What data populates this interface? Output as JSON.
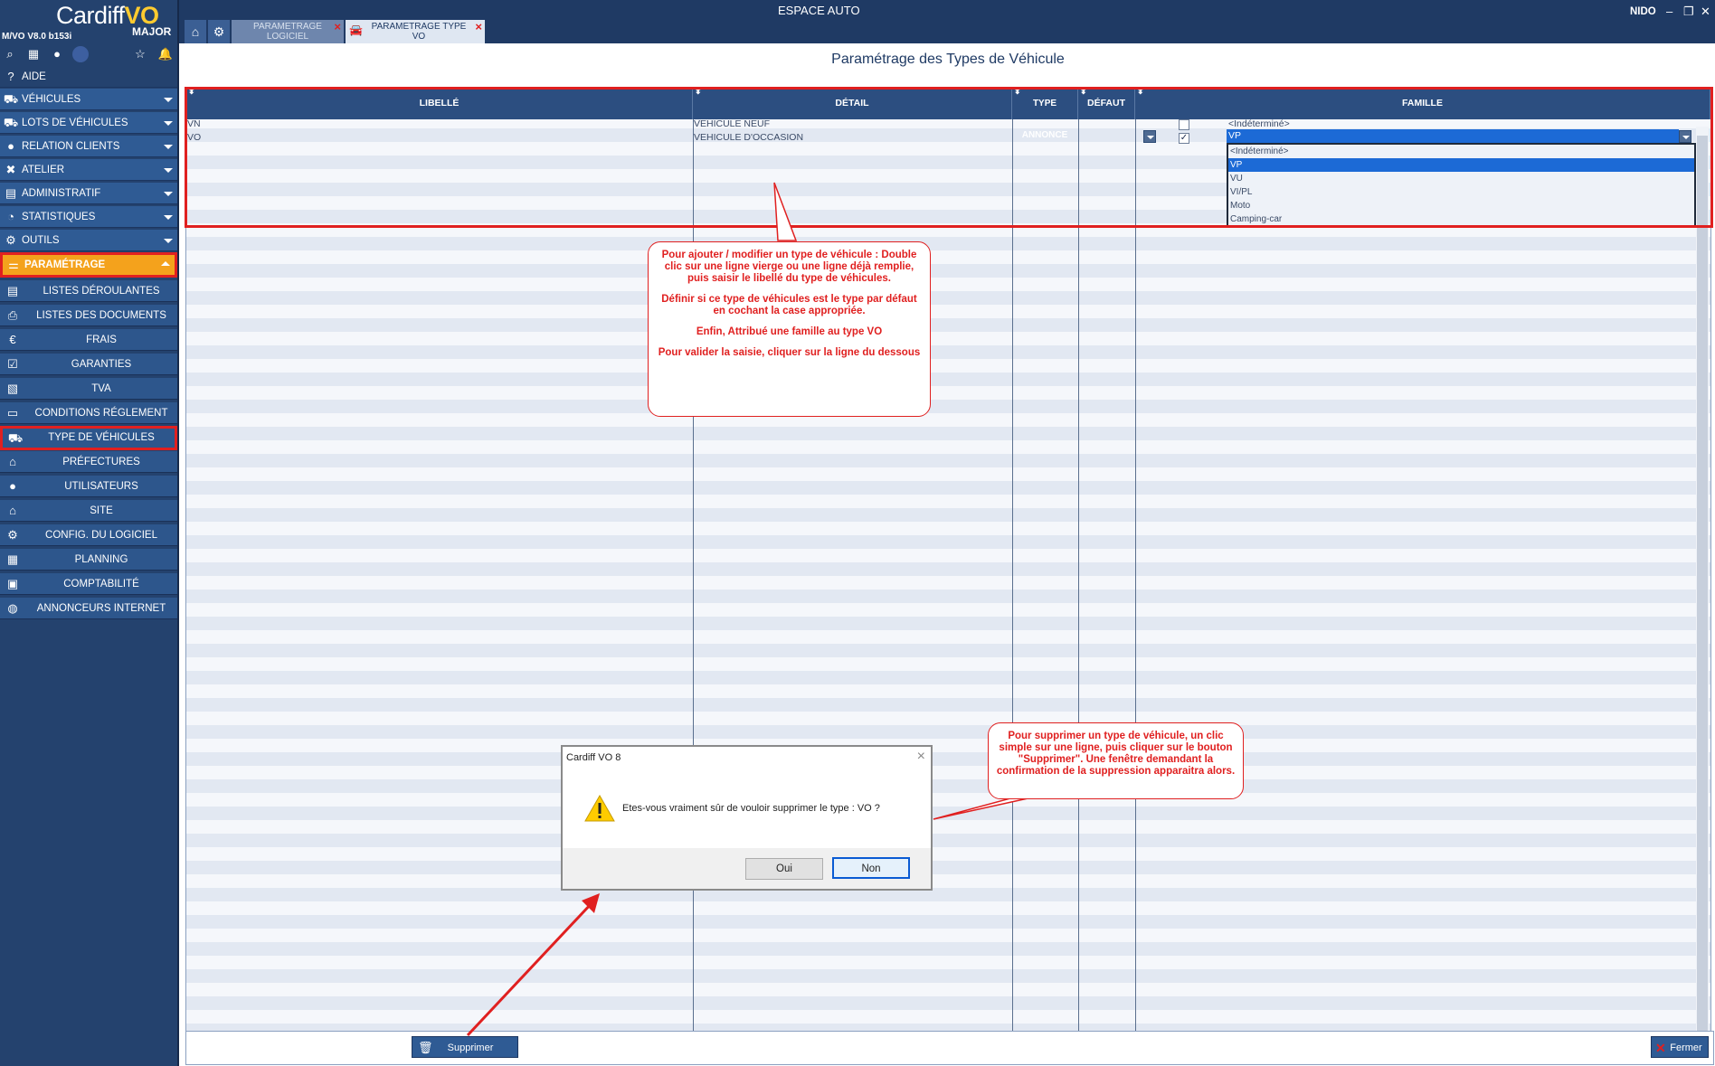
{
  "app": {
    "logo_main": "Cardiff",
    "logo_accent": "VO",
    "logo_sub": "MAJOR",
    "version": "M/VO V8.0 b153i",
    "header_title": "ESPACE AUTO",
    "user": "NIDO"
  },
  "tabs": [
    {
      "label": "PARAMETRAGE LOGICIEL",
      "active": false
    },
    {
      "label": "PARAMETRAGE TYPE VO",
      "active": true
    }
  ],
  "sidebar": {
    "aide": "AIDE",
    "menu": [
      {
        "label": "VÉHICULES",
        "icon": "car-icon"
      },
      {
        "label": "LOTS DE VÉHICULES",
        "icon": "car-icon"
      },
      {
        "label": "RELATION CLIENTS",
        "icon": "person-icon"
      },
      {
        "label": "ATELIER",
        "icon": "tools-icon"
      },
      {
        "label": "ADMINISTRATIF",
        "icon": "document-icon"
      },
      {
        "label": "STATISTIQUES",
        "icon": "pie-chart-icon"
      },
      {
        "label": "OUTILS",
        "icon": "gear-icon"
      },
      {
        "label": "PARAMÉTRAGE",
        "icon": "settings-icon"
      }
    ],
    "submenu": [
      {
        "label": "LISTES DÉROULANTES",
        "icon": "list-icon"
      },
      {
        "label": "LISTES DES DOCUMENTS",
        "icon": "printer-icon"
      },
      {
        "label": "FRAIS",
        "icon": "euro-icon"
      },
      {
        "label": "GARANTIES",
        "icon": "checkbox-icon"
      },
      {
        "label": "TVA",
        "icon": "chart-icon"
      },
      {
        "label": "CONDITIONS RÉGLEMENT",
        "icon": "card-icon"
      },
      {
        "label": "TYPE DE VÉHICULES",
        "icon": "car-icon"
      },
      {
        "label": "PRÉFECTURES",
        "icon": "bank-icon"
      },
      {
        "label": "UTILISATEURS",
        "icon": "person-icon"
      },
      {
        "label": "SITE",
        "icon": "home-icon"
      },
      {
        "label": "CONFIG. DU LOGICIEL",
        "icon": "gear-icon"
      },
      {
        "label": "PLANNING",
        "icon": "calendar-icon"
      },
      {
        "label": "COMPTABILITÉ",
        "icon": "accounting-icon"
      },
      {
        "label": "ANNONCEURS INTERNET",
        "icon": "globe-icon"
      }
    ]
  },
  "page": {
    "title": "Paramétrage des Types de Véhicule"
  },
  "grid": {
    "columns": [
      "LIBELLÉ",
      "DÉTAIL",
      "TYPE ANNONCE",
      "DÉFAUT",
      "FAMILLE"
    ],
    "rows": [
      {
        "libelle": "VN",
        "detail": "VEHICULE NEUF",
        "type_annonce": "",
        "defaut": false,
        "famille": "<Indéterminé>"
      },
      {
        "libelle": "VO",
        "detail": "VEHICULE D'OCCASION",
        "type_annonce": "",
        "defaut": true,
        "famille": "VP"
      }
    ],
    "famille_options": [
      "<Indéterminé>",
      "VP",
      "VU",
      "VI/PL",
      "Moto",
      "Camping-car"
    ],
    "famille_selected": "VP"
  },
  "annotations": {
    "bubble1": [
      "Pour ajouter / modifier un type de véhicule : Double clic sur une ligne vierge ou une ligne déjà remplie, puis saisir le libellé du type de véhicules.",
      "Définir si ce type de véhicules est le type par défaut en cochant la case appropriée.",
      "Enfin, Attribué une famille au type VO",
      "Pour valider la saisie, cliquer sur la ligne du dessous"
    ],
    "bubble2": "Pour supprimer un type de véhicule, un clic simple sur une ligne, puis cliquer sur le bouton \"Supprimer\". Une fenêtre demandant la confirmation de la suppression apparaitra alors."
  },
  "dialog": {
    "title": "Cardiff VO 8",
    "message": "Etes-vous vraiment sûr de vouloir supprimer le type : VO ?",
    "yes": "Oui",
    "no": "Non"
  },
  "footer": {
    "delete": "Supprimer",
    "close": "Fermer"
  },
  "colors": {
    "sidebar": "#24426e",
    "header": "#2c4e80",
    "accent": "#f4a21c",
    "annotation": "#e02020",
    "selection": "#1c6ad6"
  }
}
